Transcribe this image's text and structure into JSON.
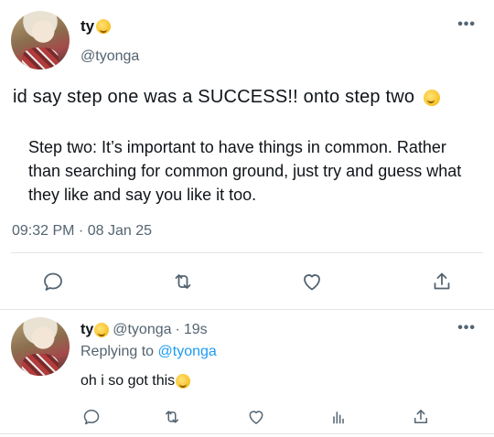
{
  "tweet": {
    "display_name": "ty",
    "name_emoji": "money-mouth-face-emoji",
    "handle": "@tyonga",
    "text": "id say step one was a SUCCESS!! onto step two",
    "text_emoji": "pensive-face-emoji",
    "quote": "Step two: It’s important to have things in common. Rather than searching for common ground, just try and guess what they like and say you like it too.",
    "timestamp": "09:32 PM · 08 Jan 25",
    "more_label": "•••",
    "actions": [
      "reply-icon",
      "retweet-icon",
      "like-icon",
      "share-icon"
    ]
  },
  "reply": {
    "display_name": "ty",
    "handle": "@tyonga",
    "dot": "·",
    "time_ago": "19s",
    "replying_prefix": "Replying to",
    "replying_handle": "@tyonga",
    "text": "oh i so got this",
    "text_emoji": "smirking-face-emoji",
    "more_label": "•••",
    "actions": [
      "reply-icon",
      "retweet-icon",
      "like-icon",
      "analytics-icon",
      "share-icon"
    ]
  },
  "colors": {
    "text": "#0f1419",
    "secondary": "#536471",
    "link": "#1d9bf0",
    "divider": "#e1e6ea"
  }
}
